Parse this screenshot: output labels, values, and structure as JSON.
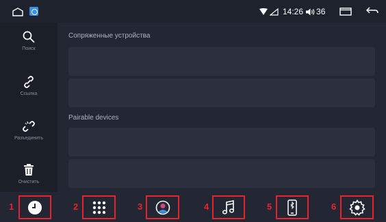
{
  "status_bar": {
    "time": "14:26",
    "volume": "36",
    "icons": [
      "home-icon",
      "app-icon",
      "wifi-icon",
      "signal-icon",
      "volume-icon",
      "window-icon",
      "back-icon"
    ]
  },
  "sidebar": {
    "items": [
      {
        "icon": "search-icon",
        "label": "Поиск"
      },
      {
        "icon": "link-icon",
        "label": "Ссылка"
      },
      {
        "icon": "unlink-icon",
        "label": "Разъединить"
      },
      {
        "icon": "trash-icon",
        "label": "Очистить"
      }
    ]
  },
  "main": {
    "paired_title": "Сопряженные устройства",
    "pairable_title": "Pairable devices"
  },
  "bottom_nav": {
    "items": [
      {
        "number": "1",
        "icon": "clock-icon"
      },
      {
        "number": "2",
        "icon": "apps-grid-icon"
      },
      {
        "number": "3",
        "icon": "contact-icon"
      },
      {
        "number": "4",
        "icon": "music-icon"
      },
      {
        "number": "5",
        "icon": "bluetooth-phone-icon"
      },
      {
        "number": "6",
        "icon": "settings-icon"
      }
    ]
  },
  "colors": {
    "background": "#232733",
    "sidebar": "#1b1f28",
    "card": "#2b303c",
    "highlight": "#e8232b",
    "accent": "#3a8fe8"
  }
}
